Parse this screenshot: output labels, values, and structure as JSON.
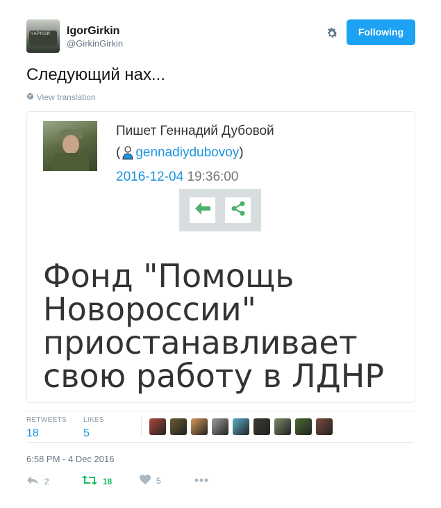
{
  "header": {
    "display_name": "IgorGirkin",
    "username": "@GirkinGirkin",
    "follow_label": "Following",
    "avatar_text": "ЧАРНОЙ"
  },
  "tweet": {
    "text": "Следующий нах...",
    "translate_label": "View translation"
  },
  "card": {
    "author_line": "Пишет Геннадий Дубовой",
    "handle_open": "(",
    "handle": "gennadiydubovoy",
    "handle_close": ")",
    "date_link": "2016-12-04",
    "time": "19:36:00",
    "headline": "Фонд \"Помощь Новороссии\" приостанавливает свою работу в ЛДНР"
  },
  "stats": {
    "retweets_label": "RETWEETS",
    "retweets_value": "18",
    "likes_label": "LIKES",
    "likes_value": "5",
    "liker_colors": [
      "#b0473f",
      "#6b5a33",
      "#d69a56",
      "#9e9e9e",
      "#5ab0c9",
      "#3b3b2f",
      "#7b8a6a",
      "#4c6b2f",
      "#7a4b3a"
    ]
  },
  "timestamp": "6:58 PM - 4 Dec 2016",
  "actions": {
    "reply_count": "2",
    "retweet_count": "18",
    "like_count": "5"
  },
  "colors": {
    "accent": "#1da1f2",
    "retweet": "#17bf63",
    "card_action": "#4caf6e"
  }
}
